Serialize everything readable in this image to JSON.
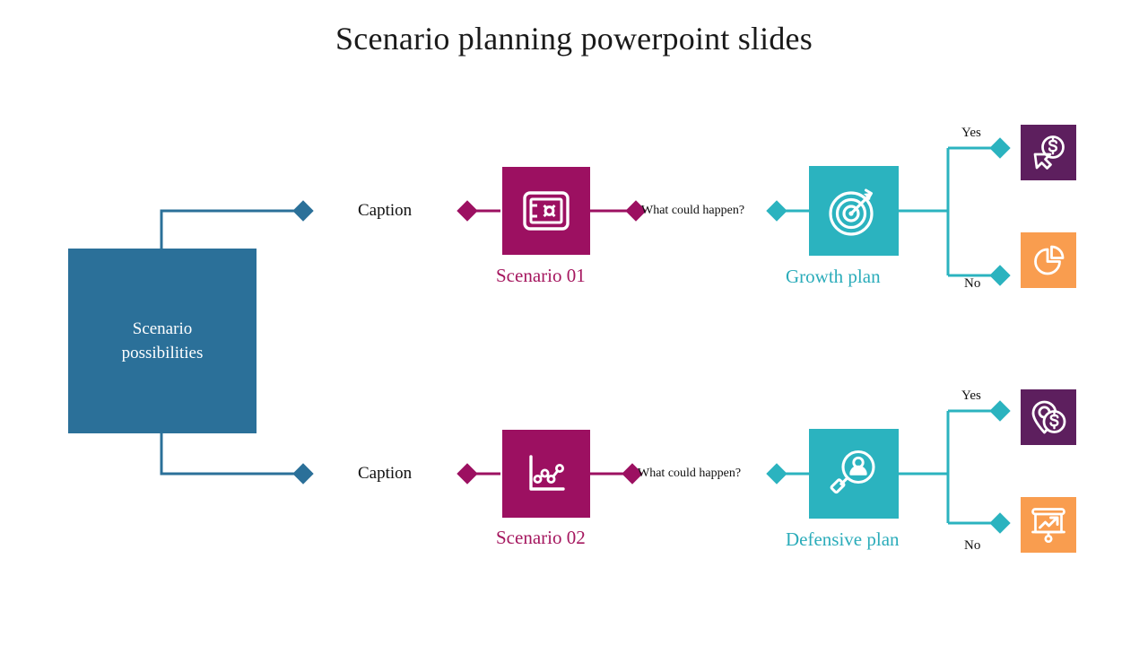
{
  "slide": {
    "title": "Scenario planning powerpoint slides",
    "background": "#ffffff"
  },
  "colors": {
    "root_blue": "#2b7099",
    "scenario_magenta": "#9c1061",
    "plan_teal": "#2bb3bf",
    "result_purple": "#5d1f5e",
    "result_orange": "#f99d4f",
    "title_text": "#1a1a1a",
    "scenario_label": "#a5175f",
    "plan_label": "#2bacba"
  },
  "root": {
    "line1": "Scenario",
    "line2": "possibilities"
  },
  "rows": [
    {
      "caption": "Caption",
      "scenario_icon": "safe-vault-icon",
      "scenario_label": "Scenario 01",
      "question": "What could happen?",
      "plan_icon": "target-arrow-icon",
      "plan_label": "Growth plan",
      "branches": [
        {
          "label": "Yes",
          "icon": "dollar-coin-click-icon",
          "color": "#5d1f5e"
        },
        {
          "label": "No",
          "icon": "pie-chart-icon",
          "color": "#f99d4f"
        }
      ]
    },
    {
      "caption": "Caption",
      "scenario_icon": "line-chart-icon",
      "scenario_label": "Scenario 02",
      "question": "What could happen?",
      "plan_icon": "magnifier-person-icon",
      "plan_label": "Defensive plan",
      "branches": [
        {
          "label": "Yes",
          "icon": "location-pin-dollar-icon",
          "color": "#5d1f5e"
        },
        {
          "label": "No",
          "icon": "presentation-growth-icon",
          "color": "#f99d4f"
        }
      ]
    }
  ]
}
